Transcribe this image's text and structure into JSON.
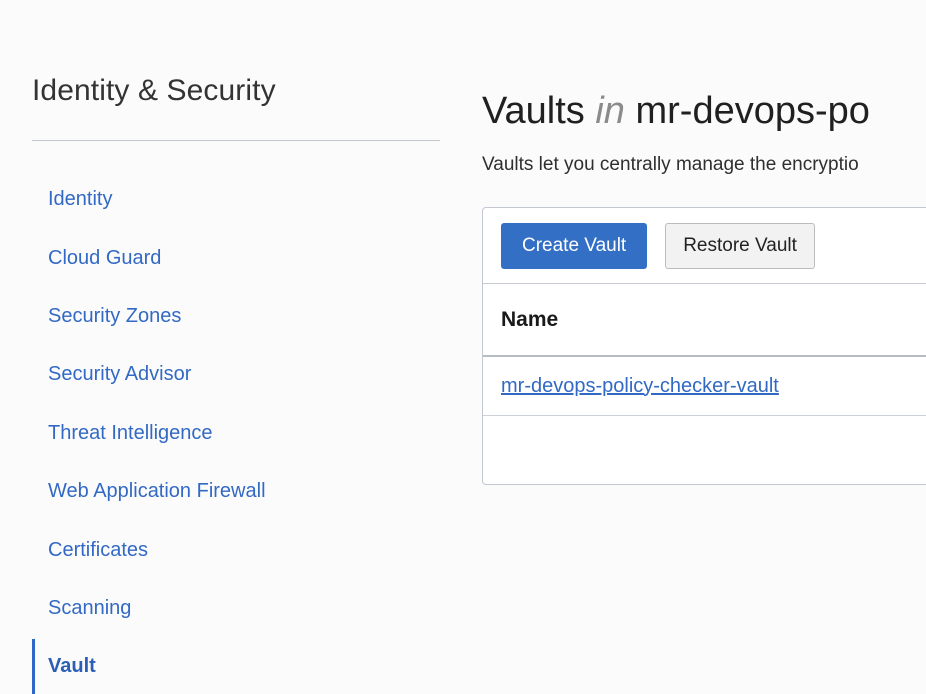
{
  "sidebar": {
    "title": "Identity & Security",
    "items": [
      {
        "label": "Identity",
        "active": false
      },
      {
        "label": "Cloud Guard",
        "active": false
      },
      {
        "label": "Security Zones",
        "active": false
      },
      {
        "label": "Security Advisor",
        "active": false
      },
      {
        "label": "Threat Intelligence",
        "active": false
      },
      {
        "label": "Web Application Firewall",
        "active": false
      },
      {
        "label": "Certificates",
        "active": false
      },
      {
        "label": "Scanning",
        "active": false
      },
      {
        "label": "Vault",
        "active": true
      }
    ]
  },
  "main": {
    "title_prefix": "Vaults",
    "title_in": "in",
    "title_scope": "mr-devops-po",
    "subtitle": "Vaults let you centrally manage the encryptio",
    "toolbar": {
      "create_label": "Create Vault",
      "restore_label": "Restore Vault"
    },
    "table": {
      "columns": [
        "Name"
      ],
      "rows": [
        {
          "name": "mr-devops-policy-checker-vault"
        }
      ]
    }
  },
  "colors": {
    "link": "#3269c4",
    "primary_button": "#336fc4",
    "active_indicator": "#2e67c4",
    "page_background": "#fbfbfb",
    "panel_border": "#c3c8d0"
  }
}
